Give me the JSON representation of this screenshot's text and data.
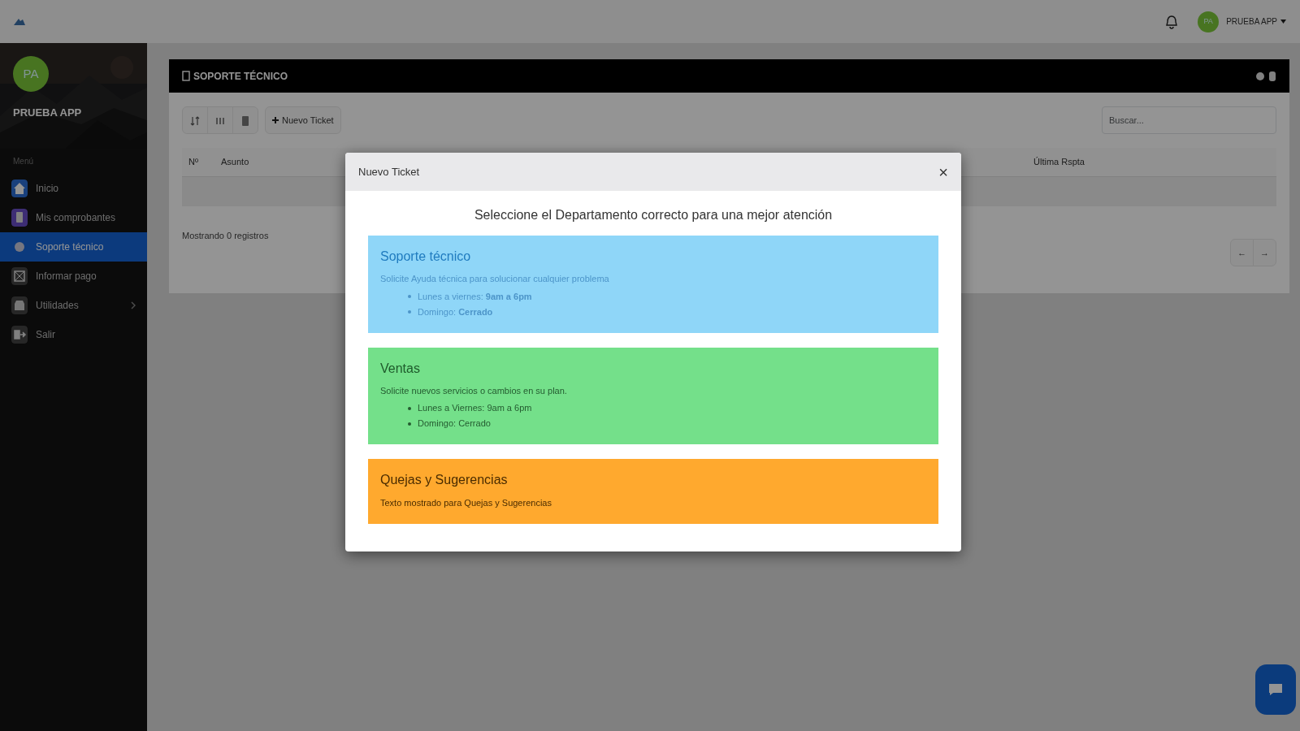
{
  "topbar": {
    "user": {
      "initials": "PA",
      "name": "PRUEBA APP"
    }
  },
  "sidebar": {
    "profile": {
      "initials": "PA",
      "name": "PRUEBA APP"
    },
    "section": "Menú",
    "items": [
      {
        "label": "Inicio",
        "selected": false,
        "has_submenu": false
      },
      {
        "label": "Mis comprobantes",
        "selected": false,
        "has_submenu": false
      },
      {
        "label": "Soporte técnico",
        "selected": true,
        "has_submenu": false
      },
      {
        "label": "Informar pago",
        "selected": false,
        "has_submenu": false
      },
      {
        "label": "Utilidades",
        "selected": false,
        "has_submenu": true
      },
      {
        "label": "Salir",
        "selected": false,
        "has_submenu": false
      }
    ]
  },
  "panel": {
    "title": "SOPORTE TÉCNICO",
    "new_button": "Nuevo Ticket",
    "search": {
      "placeholder": "Buscar..."
    },
    "table": {
      "columns": [
        "Nº",
        "Asunto",
        "Última Rspta"
      ]
    },
    "footer": "Mostrando 0 registros",
    "pager": [
      "←",
      "→"
    ]
  },
  "modal": {
    "title": "Nuevo Ticket",
    "close": "×",
    "heading": "Seleccione el Departamento correcto para una mejor atención",
    "departments": [
      {
        "kind": "info",
        "color": "#8fd6f8",
        "title": "Soporte técnico",
        "description": "Solicite Ayuda técnica para solucionar cualquier problema",
        "hours": [
          "Lunes a viernes: **9am a 6pm**",
          "Domingo: **Cerrado**"
        ]
      },
      {
        "kind": "success",
        "color": "#74e08a",
        "title": "Ventas",
        "description": "Solicite nuevos servicios o cambios en su plan.",
        "hours": [
          "Lunes a Viernes: 9am a 6pm",
          "Domingo: Cerrado"
        ]
      },
      {
        "kind": "warning",
        "color": "#ffa92e",
        "title": "Quejas y Sugerencias",
        "description": "Texto mostrado para Quejas y Sugerencias"
      }
    ]
  }
}
